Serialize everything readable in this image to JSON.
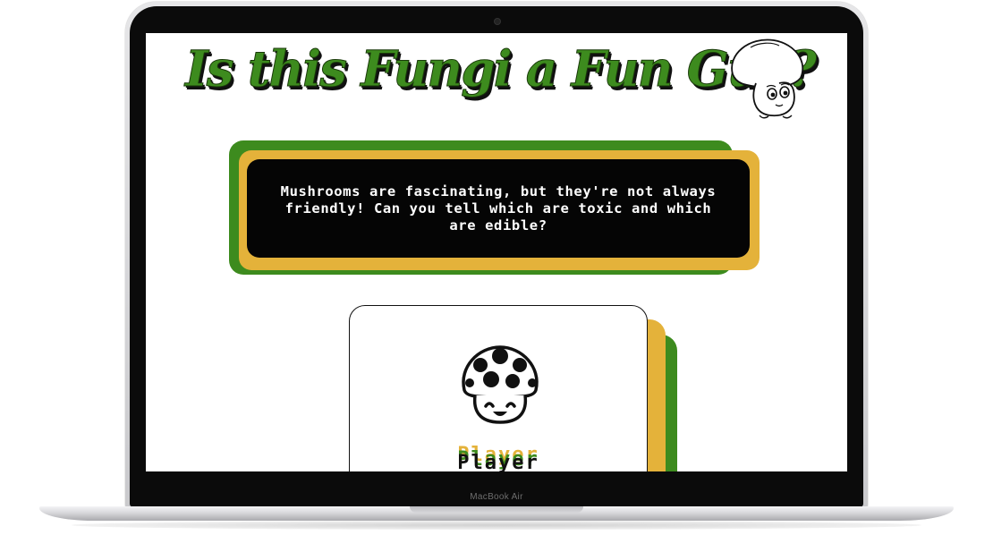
{
  "device": {
    "brand_label": "MacBook Air"
  },
  "page": {
    "title": "Is this Fungi a Fun Guy?",
    "intro_text": "Mushrooms are fascinating, but they're not always friendly! Can you tell which are toxic and which are edible?",
    "player_label": "Player"
  },
  "colors": {
    "green": "#3d8b1e",
    "yellow": "#e4b23a",
    "black": "#050505"
  },
  "icons": {
    "hero": "cute-mushroom-character-icon",
    "card": "spotted-mushroom-icon"
  }
}
